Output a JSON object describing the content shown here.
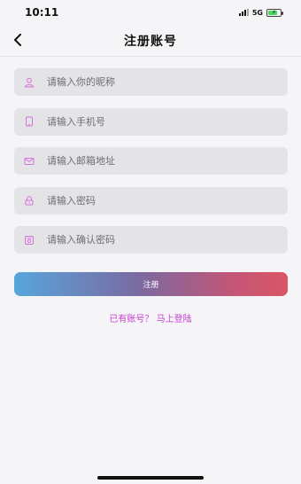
{
  "status_bar": {
    "time": "10:11",
    "network": "5G"
  },
  "nav": {
    "title": "注册账号"
  },
  "form": {
    "fields": [
      {
        "icon": "user-icon",
        "placeholder": "请输入你的昵称",
        "value": ""
      },
      {
        "icon": "phone-icon",
        "placeholder": "请输入手机号",
        "value": ""
      },
      {
        "icon": "mail-icon",
        "placeholder": "请输入邮箱地址",
        "value": ""
      },
      {
        "icon": "lock-icon",
        "placeholder": "请输入密码",
        "value": ""
      },
      {
        "icon": "confirm-lock-icon",
        "placeholder": "请输入确认密码",
        "value": ""
      }
    ],
    "submit_label": "注册",
    "login_link": "已有账号？ 马上登陆"
  },
  "colors": {
    "accent": "#c43ccf",
    "button_gradient_start": "#57a6dc",
    "button_gradient_end": "#da5565",
    "field_bg": "#e4e4e6"
  }
}
